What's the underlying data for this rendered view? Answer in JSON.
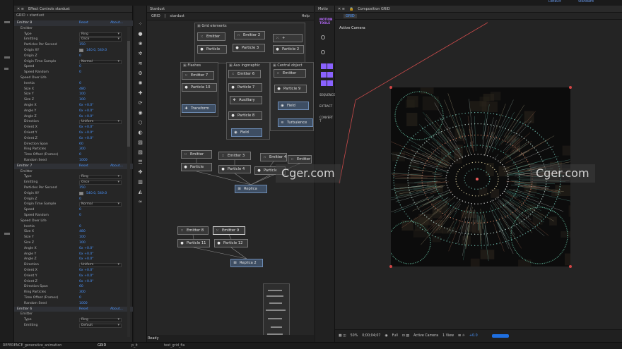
{
  "topbar": {
    "left_hint": "Default",
    "right_hint": "Standard"
  },
  "effect_controls": {
    "tab_title": "Effect Controls stardust",
    "subtitle": "GRID • stardust",
    "rows": [
      {
        "t": "hdr",
        "d": 0,
        "label": "Emitter 8",
        "reset": "Reset",
        "about": "About..."
      },
      {
        "t": "row",
        "d": 1,
        "label": "Emitter"
      },
      {
        "t": "row",
        "d": 2,
        "label": "Type",
        "box": "Ring"
      },
      {
        "t": "row",
        "d": 2,
        "label": "Emitting",
        "box": "Once"
      },
      {
        "t": "row",
        "d": 2,
        "label": "Particles Per Second",
        "val": "150"
      },
      {
        "t": "row",
        "d": 2,
        "label": "Origin XY",
        "val2": "140.0, 540.0",
        "sw": "#8a8a8a"
      },
      {
        "t": "row",
        "d": 2,
        "label": "Origin Z",
        "val": "0"
      },
      {
        "t": "row",
        "d": 2,
        "label": "Origin Time Sample",
        "box": "Normal"
      },
      {
        "t": "row",
        "d": 2,
        "label": "Speed",
        "val": "0"
      },
      {
        "t": "row",
        "d": 2,
        "label": "Speed Random",
        "val": "0"
      },
      {
        "t": "row",
        "d": 1,
        "label": "Speed Over Life",
        "val": ""
      },
      {
        "t": "row",
        "d": 2,
        "label": "Inertia",
        "val": "0"
      },
      {
        "t": "row",
        "d": 2,
        "label": "Size X",
        "val": "480"
      },
      {
        "t": "row",
        "d": 2,
        "label": "Size Y",
        "val": "100"
      },
      {
        "t": "row",
        "d": 2,
        "label": "Size Z",
        "val": "100"
      },
      {
        "t": "row",
        "d": 2,
        "label": "Angle X",
        "val": "0x +0.0°"
      },
      {
        "t": "row",
        "d": 2,
        "label": "Angle Y",
        "val": "0x +0.0°"
      },
      {
        "t": "row",
        "d": 2,
        "label": "Angle Z",
        "val": "0x +0.0°"
      },
      {
        "t": "row",
        "d": 2,
        "label": "Direction",
        "box": "Uniform"
      },
      {
        "t": "row",
        "d": 2,
        "label": "Orient X",
        "val": "0x +0.0°"
      },
      {
        "t": "row",
        "d": 2,
        "label": "Orient Y",
        "val": "0x +0.0°"
      },
      {
        "t": "row",
        "d": 2,
        "label": "Orient Z",
        "val": "0x +0.0°"
      },
      {
        "t": "row",
        "d": 2,
        "label": "Direction Span",
        "val": "60"
      },
      {
        "t": "row",
        "d": 2,
        "label": "Ring Particles",
        "val": "300"
      },
      {
        "t": "row",
        "d": 2,
        "label": "Time Offset (Frames)",
        "val": "0"
      },
      {
        "t": "row",
        "d": 2,
        "label": "Random Seed",
        "val": "1000"
      },
      {
        "t": "hdr",
        "d": 0,
        "label": "Emitter 7",
        "reset": "Reset",
        "about": "About..."
      },
      {
        "t": "row",
        "d": 1,
        "label": "Emitter"
      },
      {
        "t": "row",
        "d": 2,
        "label": "Type",
        "box": "Ring"
      },
      {
        "t": "row",
        "d": 2,
        "label": "Emitting",
        "box": "Once"
      },
      {
        "t": "row",
        "d": 2,
        "label": "Particles Per Second",
        "val": "150"
      },
      {
        "t": "row",
        "d": 2,
        "label": "Origin XY",
        "val2": "540.0, 540.0",
        "sw": "#8a8a8a"
      },
      {
        "t": "row",
        "d": 2,
        "label": "Origin Z",
        "val": "0"
      },
      {
        "t": "row",
        "d": 2,
        "label": "Origin Time Sample",
        "box": "Normal"
      },
      {
        "t": "row",
        "d": 2,
        "label": "Speed",
        "val": "0"
      },
      {
        "t": "row",
        "d": 2,
        "label": "Speed Random",
        "val": "0"
      },
      {
        "t": "row",
        "d": 1,
        "label": "Speed Over Life",
        "val": ""
      },
      {
        "t": "row",
        "d": 2,
        "label": "Inertia",
        "val": "0"
      },
      {
        "t": "row",
        "d": 2,
        "label": "Size X",
        "val": "480"
      },
      {
        "t": "row",
        "d": 2,
        "label": "Size Y",
        "val": "100"
      },
      {
        "t": "row",
        "d": 2,
        "label": "Size Z",
        "val": "100"
      },
      {
        "t": "row",
        "d": 2,
        "label": "Angle X",
        "val": "0x +0.0°"
      },
      {
        "t": "row",
        "d": 2,
        "label": "Angle Y",
        "val": "0x +0.0°"
      },
      {
        "t": "row",
        "d": 2,
        "label": "Angle Z",
        "val": "0x +0.0°"
      },
      {
        "t": "row",
        "d": 2,
        "label": "Direction",
        "box": "Uniform"
      },
      {
        "t": "row",
        "d": 2,
        "label": "Orient X",
        "val": "0x +0.0°"
      },
      {
        "t": "row",
        "d": 2,
        "label": "Orient Y",
        "val": "0x +0.0°"
      },
      {
        "t": "row",
        "d": 2,
        "label": "Orient Z",
        "val": "0x +0.0°"
      },
      {
        "t": "row",
        "d": 2,
        "label": "Direction Span",
        "val": "60"
      },
      {
        "t": "row",
        "d": 2,
        "label": "Ring Particles",
        "val": "300"
      },
      {
        "t": "row",
        "d": 2,
        "label": "Time Offset (Frames)",
        "val": "0"
      },
      {
        "t": "row",
        "d": 2,
        "label": "Random Seed",
        "val": "1000"
      },
      {
        "t": "hdr",
        "d": 0,
        "label": "Emitter 6",
        "reset": "Reset",
        "about": "About..."
      },
      {
        "t": "row",
        "d": 1,
        "label": "Emitter"
      },
      {
        "t": "row",
        "d": 2,
        "label": "Type",
        "box": "Ring"
      },
      {
        "t": "row",
        "d": 2,
        "label": "Emitting",
        "box": "Default"
      }
    ]
  },
  "node_editor": {
    "panel_tab": "Stardust",
    "tab_grid": "GRID",
    "tab_stardust": "stardust",
    "help": "Help",
    "status": "Ready",
    "groups": [
      {
        "id": "g1",
        "title": "Grid elements"
      },
      {
        "id": "g2",
        "title": "Flashes"
      },
      {
        "id": "g3",
        "title": "Aux ingoraphic"
      },
      {
        "id": "g4",
        "title": "Central object"
      }
    ],
    "nodes": [
      {
        "id": "n1",
        "label": "Emitter",
        "ic": "emitter"
      },
      {
        "id": "n2",
        "label": "Emitter 2",
        "ic": "emitter"
      },
      {
        "id": "n3",
        "label": "+",
        "ic": "emitter"
      },
      {
        "id": "n4",
        "label": "Particle",
        "ic": "particle"
      },
      {
        "id": "n5",
        "label": "Particle 3",
        "ic": "particle"
      },
      {
        "id": "n6",
        "label": "Particle 2",
        "ic": "particle"
      },
      {
        "id": "n7",
        "label": "Emitter 7",
        "ic": "emitter"
      },
      {
        "id": "n8",
        "label": "Particle 10",
        "ic": "particle"
      },
      {
        "id": "n9",
        "label": "Transform",
        "ic": "transform"
      },
      {
        "id": "n10",
        "label": "Emitter 6",
        "ic": "emitter"
      },
      {
        "id": "n11",
        "label": "Particle 7",
        "ic": "particle"
      },
      {
        "id": "n12",
        "label": "Auxiliary",
        "ic": "aux"
      },
      {
        "id": "n13",
        "label": "Particle 8",
        "ic": "particle"
      },
      {
        "id": "n14",
        "label": "Field",
        "ic": "field"
      },
      {
        "id": "n15",
        "label": "Emitter",
        "ic": "emitter"
      },
      {
        "id": "n16",
        "label": "Particle 9",
        "ic": "particle"
      },
      {
        "id": "n17",
        "label": "Field",
        "ic": "field"
      },
      {
        "id": "n18",
        "label": "Turbulence",
        "ic": "turb"
      },
      {
        "id": "n19",
        "label": "Emitter",
        "ic": "emitter"
      },
      {
        "id": "n20",
        "label": "Emitter 3",
        "ic": "emitter"
      },
      {
        "id": "n21",
        "label": "Emitter 4",
        "ic": "emitter"
      },
      {
        "id": "n22",
        "label": "Emitter",
        "ic": "emitter"
      },
      {
        "id": "n23",
        "label": "Particle",
        "ic": "particle"
      },
      {
        "id": "n24",
        "label": "Particle 4",
        "ic": "particle"
      },
      {
        "id": "n25",
        "label": "Particle",
        "ic": "particle"
      },
      {
        "id": "n26",
        "label": "Replica",
        "ic": "replica"
      },
      {
        "id": "n27",
        "label": "Emitter 8",
        "ic": "emitter"
      },
      {
        "id": "n28",
        "label": "Emitter 9",
        "ic": "emitter"
      },
      {
        "id": "n29",
        "label": "Particle 11",
        "ic": "particle"
      },
      {
        "id": "n30",
        "label": "Particle 12",
        "ic": "particle"
      },
      {
        "id": "n31",
        "label": "Replica 2",
        "ic": "replica"
      }
    ]
  },
  "motion_tools": {
    "tab": "Motio",
    "title": "MOTION TOOLS",
    "labels": [
      "SEQUENCE",
      "EXTRACT",
      "CONVERT T"
    ]
  },
  "composition": {
    "tab_title": "Composition GRID",
    "chip": "GRID",
    "active_camera": "Active Camera",
    "footer": [
      "50%",
      "0;00;04;07",
      "Full",
      "Active Camera",
      "1 View",
      "+0.0"
    ]
  },
  "bottom_tabs": [
    "REFERENCE_generative_animation",
    "GRID",
    "p_it",
    "test_grid_fia"
  ],
  "watermark": "Cger.com",
  "colors": {
    "accent": "#3d8eff",
    "node_border": "#777777",
    "purple": "#8a62ff",
    "corner": "#d14545"
  }
}
